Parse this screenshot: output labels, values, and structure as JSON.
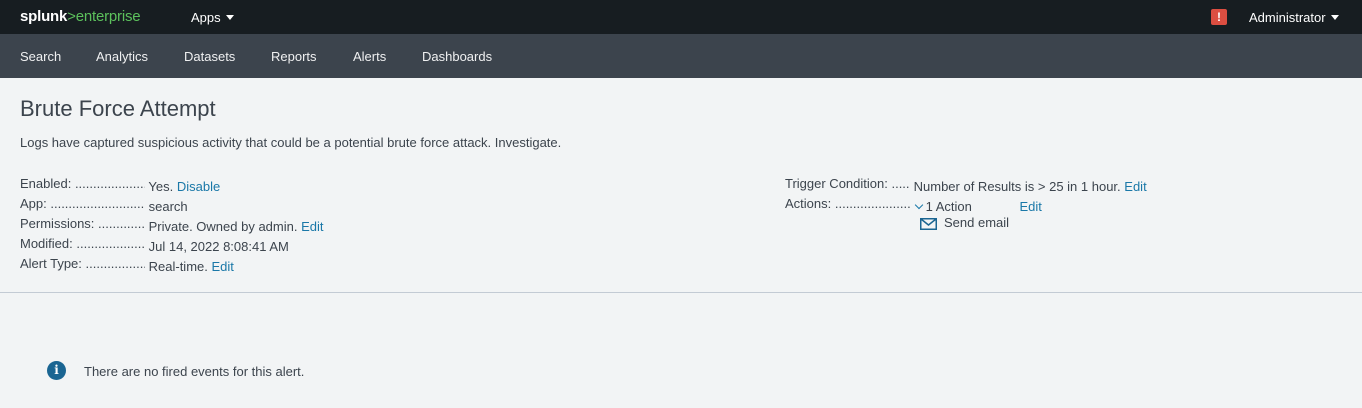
{
  "topbar": {
    "logo_brand": "splunk",
    "logo_sep": ">",
    "logo_product": "enterprise",
    "apps_label": "Apps",
    "user_label": "Administrator",
    "alert_badge": "!"
  },
  "nav": {
    "items": [
      "Search",
      "Analytics",
      "Datasets",
      "Reports",
      "Alerts",
      "Dashboards"
    ]
  },
  "alert": {
    "title": "Brute Force Attempt",
    "description": "Logs have captured suspicious activity that could be a potential brute force attack. Investigate.",
    "left_fields": [
      {
        "label": "Enabled:",
        "value": "Yes.",
        "link": "Disable"
      },
      {
        "label": "App:",
        "value": "search",
        "link": ""
      },
      {
        "label": "Permissions:",
        "value": "Private. Owned by admin.",
        "link": "Edit"
      },
      {
        "label": "Modified:",
        "value": "Jul 14, 2022 8:08:41 AM",
        "link": ""
      },
      {
        "label": "Alert Type:",
        "value": "Real-time.",
        "link": "Edit"
      }
    ],
    "trigger": {
      "label": "Trigger Condition:",
      "value": "Number of Results is > 25 in 1 hour.",
      "link": "Edit"
    },
    "actions": {
      "label": "Actions:",
      "value": "1 Action",
      "link": "Edit",
      "action_item": "Send email"
    }
  },
  "empty_state": {
    "icon": "info-icon",
    "message": "There are no fired events for this alert."
  },
  "colors": {
    "topbar_bg": "#171d21",
    "navbar_bg": "#3c444d",
    "accent_green": "#5cc05c",
    "link_blue": "#1a78a8",
    "alert_red": "#dc4e41"
  }
}
